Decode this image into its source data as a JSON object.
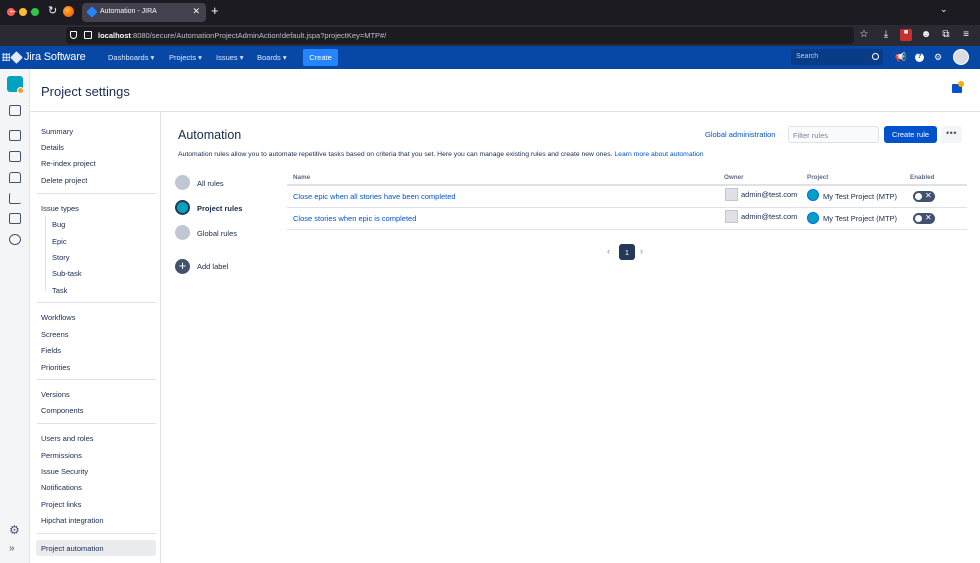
{
  "browser": {
    "tab_title": "Automation - JIRA",
    "url_host": "localhost",
    "url_rest": ":8080/secure/AutomationProjectAdminAction!default.jspa?projectKey=MTP#/"
  },
  "jira_header": {
    "brand": "Jira Software",
    "menus": [
      "Dashboards ▾",
      "Projects ▾",
      "Issues ▾",
      "Boards ▾"
    ],
    "create_label": "Create",
    "search_placeholder": "Search"
  },
  "page": {
    "title": "Project settings"
  },
  "sidebar": {
    "group1": [
      "Summary",
      "Details",
      "Re-index project",
      "Delete project"
    ],
    "issue_types_label": "Issue types",
    "issue_types": [
      "Bug",
      "Epic",
      "Story",
      "Sub-task",
      "Task"
    ],
    "group3": [
      "Workflows",
      "Screens",
      "Fields",
      "Priorities"
    ],
    "group4": [
      "Versions",
      "Components"
    ],
    "group5": [
      "Users and roles",
      "Permissions",
      "Issue Security",
      "Notifications",
      "Project links",
      "Hipchat integration"
    ],
    "active_item": "Project automation"
  },
  "automation": {
    "title": "Automation",
    "global_admin_link": "Global administration",
    "filter_placeholder": "Filter rules",
    "create_rule_label": "Create rule",
    "more_label": "•••",
    "description": "Automation rules allow you to automate repetitive tasks based on criteria that you set. Here you can manage existing rules and create new ones.",
    "learn_more": "Learn more about automation",
    "categories": [
      "All rules",
      "Project rules",
      "Global rules",
      "Add label"
    ],
    "table": {
      "headers": [
        "Name",
        "Owner",
        "Project",
        "Enabled"
      ],
      "rows": [
        {
          "name": "Close epic when all stories have been completed",
          "owner": "admin@test.com",
          "project": "My Test Project (MTP)",
          "enabled": false
        },
        {
          "name": "Close stories when epic is completed",
          "owner": "admin@test.com",
          "project": "My Test Project (MTP)",
          "enabled": false
        }
      ]
    },
    "pagination": {
      "current_page": "1"
    }
  },
  "colors": {
    "jira_header": "#0747a6",
    "primary": "#0052cc",
    "toggle_off": "#42526e"
  }
}
